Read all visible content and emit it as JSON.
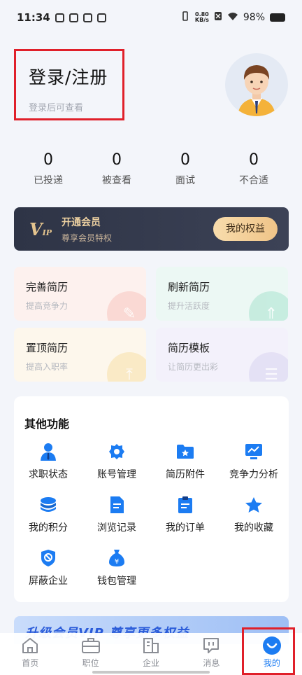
{
  "status_bar": {
    "time": "11:34",
    "net_speed_value": "0.80",
    "net_speed_unit": "KB/s",
    "battery": "98%"
  },
  "profile": {
    "login_title": "登录/注册",
    "login_subtitle": "登录后可查看"
  },
  "stats": [
    {
      "value": "0",
      "label": "已投递"
    },
    {
      "value": "0",
      "label": "被查看"
    },
    {
      "value": "0",
      "label": "面试"
    },
    {
      "value": "0",
      "label": "不合适"
    }
  ],
  "vip": {
    "logo_big": "V",
    "logo_small": "IP",
    "title": "开通会员",
    "subtitle": "尊享会员特权",
    "button": "我的权益"
  },
  "quick_actions": [
    {
      "title": "完善简历",
      "subtitle": "提高竞争力"
    },
    {
      "title": "刷新简历",
      "subtitle": "提升活跃度"
    },
    {
      "title": "置顶简历",
      "subtitle": "提高入职率"
    },
    {
      "title": "简历模板",
      "subtitle": "让简历更出彩"
    }
  ],
  "functions": {
    "title": "其他功能",
    "items": [
      {
        "label": "求职状态",
        "icon": "user-icon"
      },
      {
        "label": "账号管理",
        "icon": "gear-icon"
      },
      {
        "label": "简历附件",
        "icon": "folder-star-icon"
      },
      {
        "label": "竞争力分析",
        "icon": "chart-icon"
      },
      {
        "label": "我的积分",
        "icon": "coins-icon"
      },
      {
        "label": "浏览记录",
        "icon": "document-icon"
      },
      {
        "label": "我的订单",
        "icon": "clipboard-icon"
      },
      {
        "label": "我的收藏",
        "icon": "star-icon"
      },
      {
        "label": "屏蔽企业",
        "icon": "shield-block-icon"
      },
      {
        "label": "钱包管理",
        "icon": "money-bag-icon"
      }
    ]
  },
  "banner": {
    "text": "升级会员VIP 尊享更多权益"
  },
  "tabbar": {
    "tabs": [
      {
        "label": "首页",
        "icon": "home-icon"
      },
      {
        "label": "职位",
        "icon": "briefcase-icon"
      },
      {
        "label": "企业",
        "icon": "building-icon"
      },
      {
        "label": "消息",
        "icon": "message-icon"
      },
      {
        "label": "我的",
        "icon": "profile-icon"
      }
    ],
    "active_index": 4
  },
  "colors": {
    "accent": "#1c7cf2",
    "highlight_box": "#e0202a",
    "vip_gold": "#f0d3a2"
  }
}
